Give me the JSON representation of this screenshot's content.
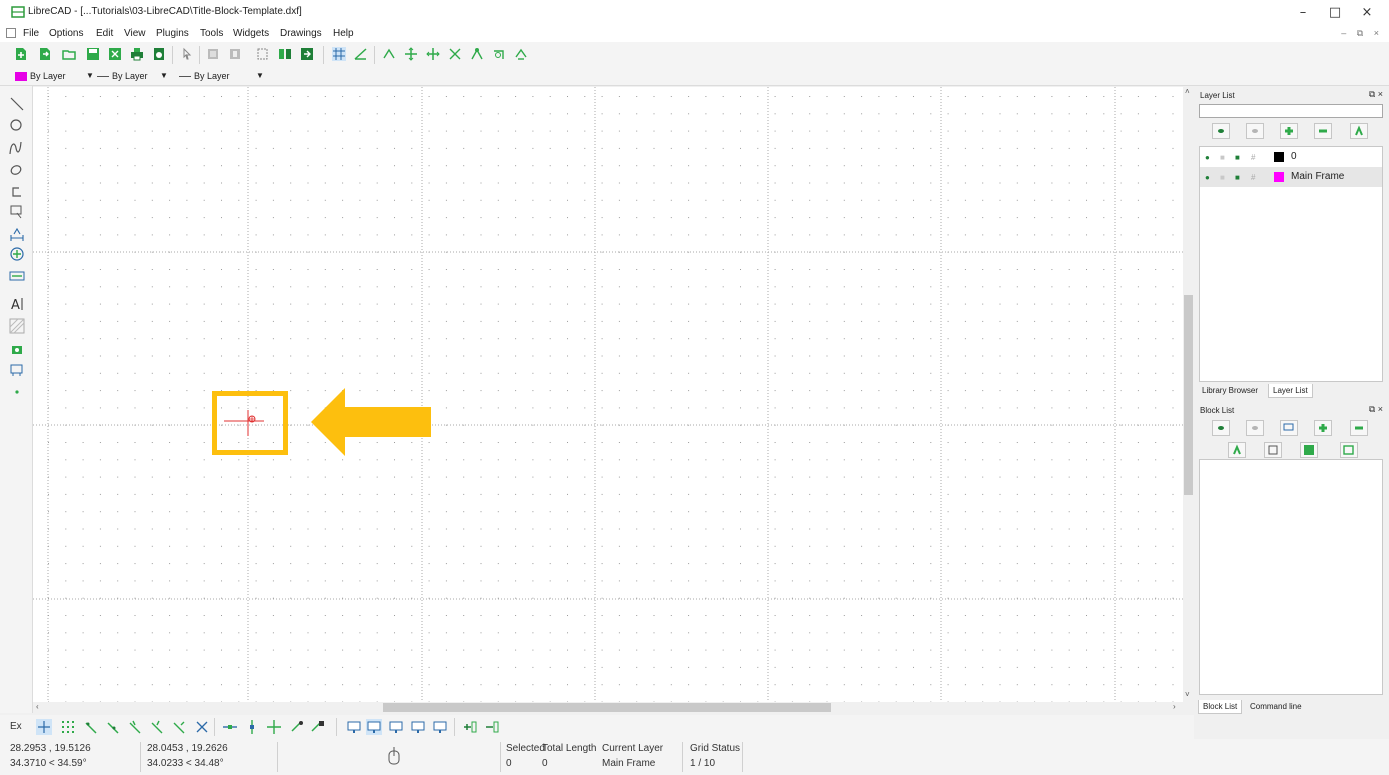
{
  "window": {
    "title": "LibreCAD - [...Tutorials\\03-LibreCAD\\Title-Block-Template.dxf]",
    "controls": [
      "–",
      "□",
      "×"
    ]
  },
  "menu": {
    "items": [
      "File",
      "Options",
      "Edit",
      "View",
      "Plugins",
      "Tools",
      "Widgets",
      "Drawings",
      "Help"
    ],
    "mdi_controls": "– ⧉ ×"
  },
  "pen_toolbar": {
    "color": "By Layer",
    "width": "By Layer",
    "linetype": "By Layer",
    "color_swatch": "#e600e6"
  },
  "layer_list": {
    "title": "Layer List",
    "filter_value": "",
    "buttons": [
      "show-all-icon",
      "hide-all-icon",
      "add-layer-icon",
      "remove-layer-icon",
      "edit-layer-icon"
    ],
    "layers": [
      {
        "name": "0",
        "color": "#000000"
      },
      {
        "name": "Main Frame",
        "color": "#ff00ff"
      }
    ]
  },
  "dock_tabs_top": [
    "Library Browser",
    "Layer List"
  ],
  "block_list": {
    "title": "Block List"
  },
  "dock_tabs_bottom": [
    "Block List",
    "Command line"
  ],
  "snapbar": {
    "ex_label": "Ex"
  },
  "status": {
    "abs_coord": "28.2953 , 19.5126",
    "abs_polar": "34.3710 < 34.59°",
    "rel_coord": "28.0453 , 19.2626",
    "rel_polar": "34.0233 < 34.48°",
    "selected_label": "Selected",
    "selected_value": "0",
    "total_length_label": "Total Length",
    "total_length_value": "0",
    "current_layer_label": "Current Layer",
    "current_layer_value": "Main Frame",
    "grid_status_label": "Grid Status",
    "grid_status_value": "1 / 10"
  },
  "colors": {
    "highlight": "#FDBF0E",
    "crosshair": "#e03030",
    "accent_green": "#1aa64a"
  }
}
